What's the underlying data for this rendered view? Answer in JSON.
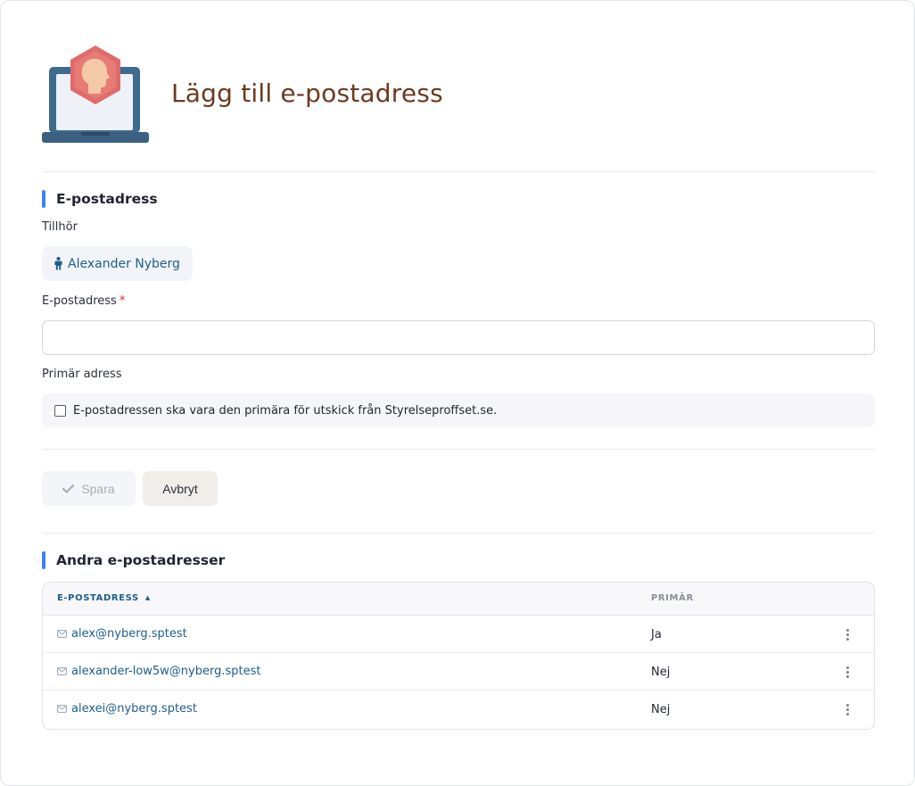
{
  "page": {
    "title": "Lägg till e-postadress"
  },
  "form": {
    "section_title": "E-postadress",
    "belongs_label": "Tillhör",
    "owner_name": "Alexander Nyberg",
    "email_label": "E-postadress",
    "required_mark": "*",
    "email_value": "",
    "primary_label": "Primär adress",
    "primary_checkbox_text": "E-postadressen ska vara den primära för utskick från Styrelseproffset.se.",
    "primary_checked": false
  },
  "actions": {
    "save_label": "Spara",
    "cancel_label": "Avbryt"
  },
  "other_emails": {
    "section_title": "Andra e-postadresser",
    "columns": {
      "email": "E-POSTADRESS",
      "sort_indicator": "▲",
      "primary": "PRIMÄR"
    },
    "rows": [
      {
        "email": "alex@nyberg.sptest",
        "primary": "Ja"
      },
      {
        "email": "alexander-low5w@nyberg.sptest",
        "primary": "Nej"
      },
      {
        "email": "alexei@nyberg.sptest",
        "primary": "Nej"
      }
    ]
  },
  "icons": {
    "logo": "laptop-person-hexagon-icon",
    "owner": "person-icon",
    "save": "check-icon",
    "row_email": "envelope-icon",
    "row_menu": "kebab-menu-icon"
  },
  "colors": {
    "title": "#6b3a1f",
    "accent_bar": "#3b82f6",
    "link": "#1b5e8c",
    "required": "#e02424",
    "logo_hexagon": "#e06b6b",
    "logo_laptop": "#3f6b8f"
  }
}
